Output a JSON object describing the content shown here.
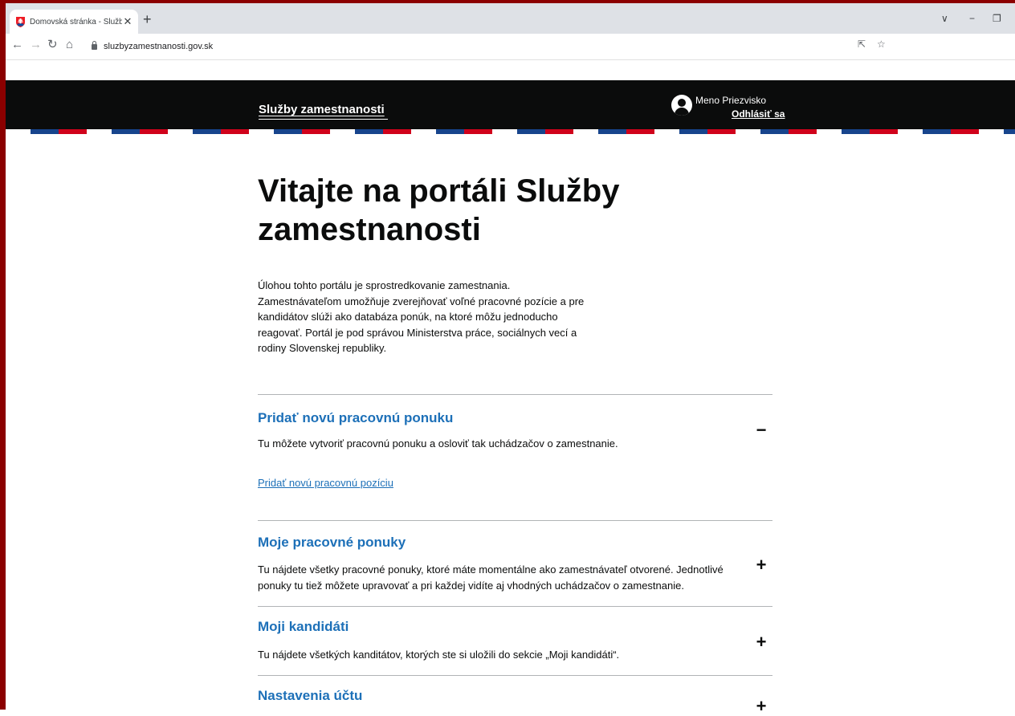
{
  "browser": {
    "tab_title": "Domovská stránka - Služby zame",
    "url": "sluzbyzamestnanosti.gov.sk"
  },
  "header": {
    "brand": "Služby zamestnanosti",
    "user_name": "Meno Priezvisko",
    "logout_label": "Odhlásiť sa"
  },
  "main": {
    "title": "Vitajte na portáli Služby zamestnanosti",
    "intro": "Úlohou tohto portálu je sprostredkovanie zamestnania. Zamestnávateľom umožňuje zverejňovať voľné pracovné pozície a pre kandidátov slúži ako databáza ponúk, na ktoré môžu jednoducho reagovať. Portál je pod správou Ministerstva práce, sociálnych vecí a rodiny Slovenskej republiky.",
    "sections": [
      {
        "title": "Pridať novú pracovnú ponuku",
        "description": "Tu môžete vytvoriť pracovnú ponuku a osloviť tak uchádzačov o zamestnanie.",
        "link": "Pridať novú pracovnú pozíciu",
        "toggle": "−",
        "expanded": true
      },
      {
        "title": "Moje pracovné ponuky",
        "description": "Tu nájdete všetky pracovné ponuky, ktoré máte momentálne ako zamestnávateľ otvorené. Jednotlivé ponuky tu tiež môžete upravovať a pri každej vidíte aj vhodných uchádzačov o zamestnanie.",
        "toggle": "+",
        "expanded": false
      },
      {
        "title": "Moji kandidáti",
        "description": "Tu nájdete všetkých kanditátov, ktorých ste si uložili do sekcie „Moji kandidáti“.",
        "toggle": "+",
        "expanded": false
      },
      {
        "title": "Nastavenia účtu",
        "toggle": "+",
        "expanded": false
      }
    ]
  },
  "colors": {
    "header_bg": "#0b0c0c",
    "link_blue": "#1d70b8",
    "stripe_blue": "#17448c",
    "stripe_red": "#d0021b"
  }
}
